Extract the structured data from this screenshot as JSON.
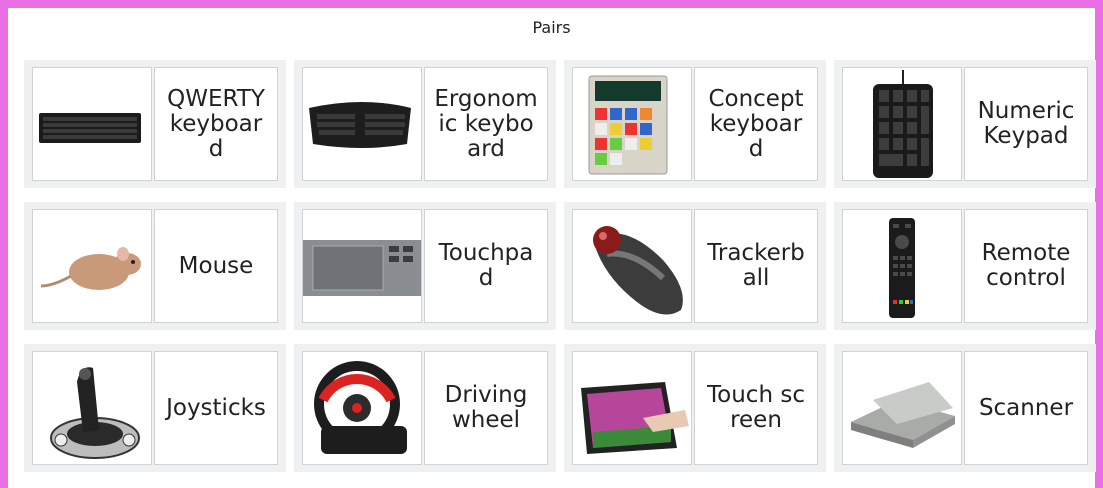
{
  "title": "Pairs",
  "cards": [
    {
      "label": "QWERTY keyboard",
      "icon": "keyboard-icon"
    },
    {
      "label": "Ergonomic keyboard",
      "icon": "ergonomic-keyboard-icon"
    },
    {
      "label": "Concept keyboard",
      "icon": "concept-keyboard-icon"
    },
    {
      "label": "Numeric Keypad",
      "icon": "numeric-keypad-icon"
    },
    {
      "label": "Mouse",
      "icon": "mouse-animal-icon"
    },
    {
      "label": "Touchpad",
      "icon": "touchpad-icon"
    },
    {
      "label": "Trackerball",
      "icon": "trackerball-icon"
    },
    {
      "label": "Remote control",
      "icon": "remote-control-icon"
    },
    {
      "label": "Joysticks",
      "icon": "joystick-icon"
    },
    {
      "label": "Driving wheel",
      "icon": "driving-wheel-icon"
    },
    {
      "label": "Touch screen",
      "icon": "touch-screen-icon"
    },
    {
      "label": "Scanner",
      "icon": "scanner-icon"
    }
  ]
}
